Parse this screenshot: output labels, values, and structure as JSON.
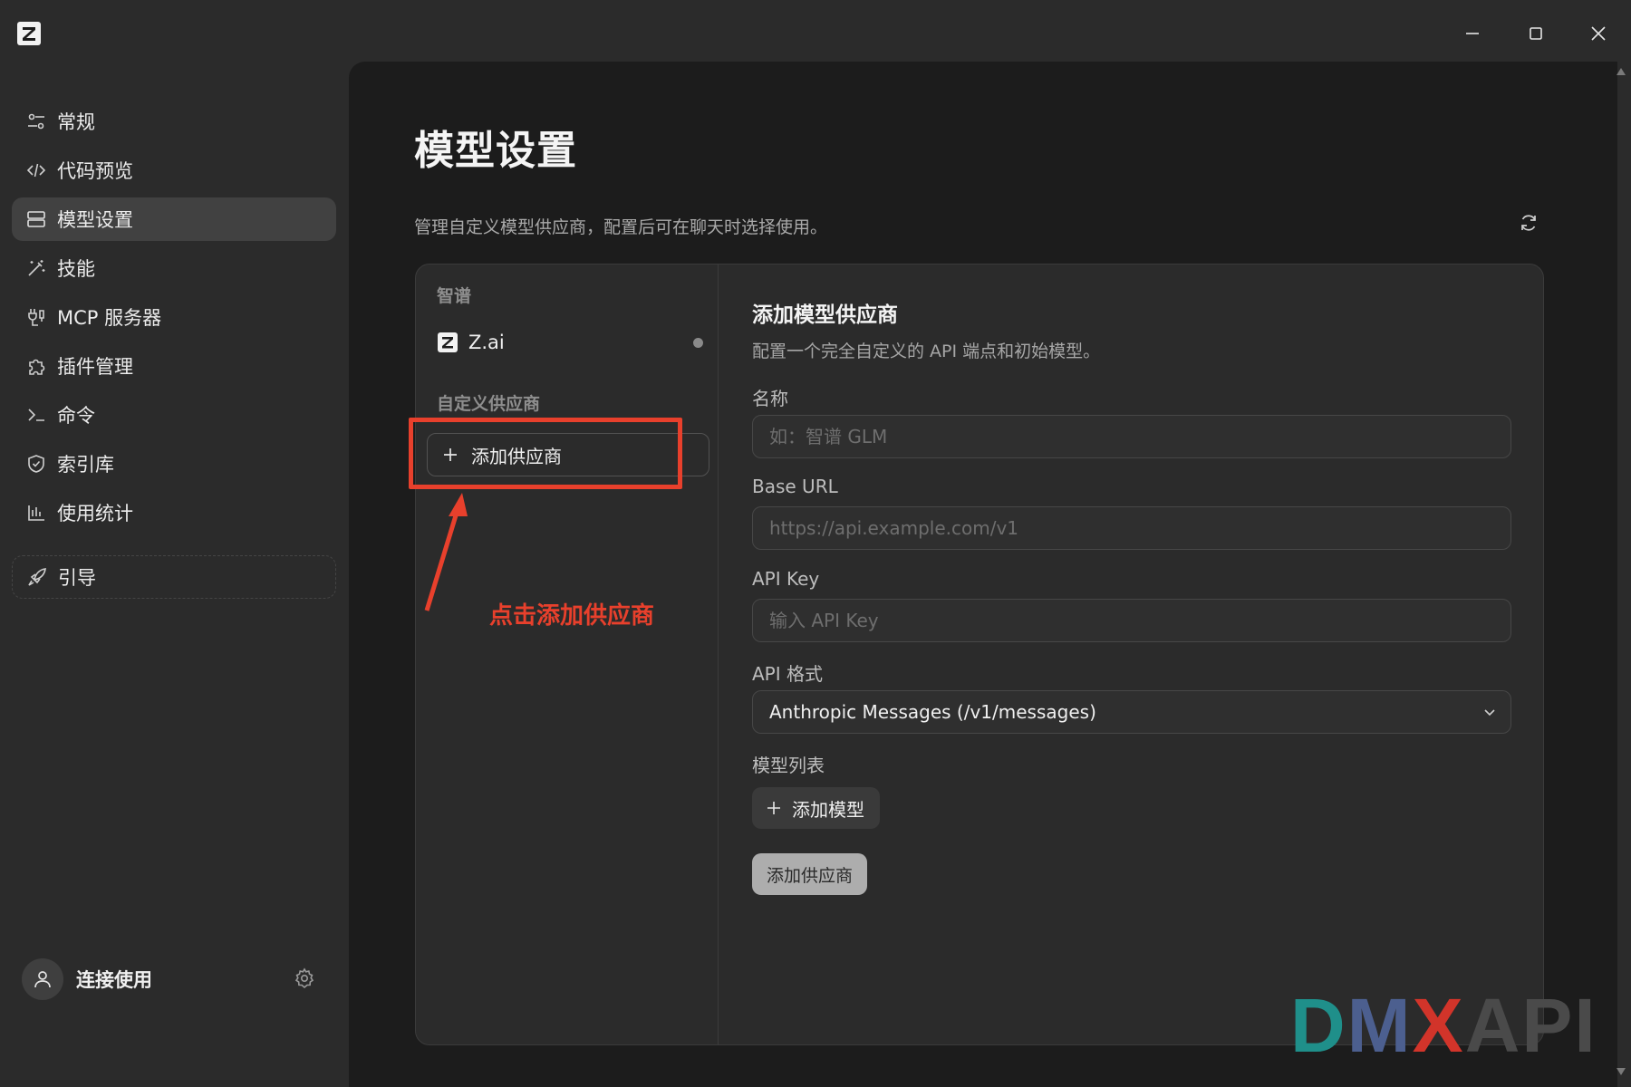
{
  "window": {
    "logo_icon": "z-logo-icon",
    "controls": [
      "minimize-icon",
      "maximize-icon",
      "close-icon"
    ]
  },
  "sidebar": {
    "items": [
      {
        "label": "常规",
        "icon": "sliders-icon"
      },
      {
        "label": "代码预览",
        "icon": "code-icon"
      },
      {
        "label": "模型设置",
        "icon": "server-icon",
        "active": true
      },
      {
        "label": "技能",
        "icon": "magic-wand-icon"
      },
      {
        "label": "MCP 服务器",
        "icon": "plug-icon"
      },
      {
        "label": "插件管理",
        "icon": "puzzle-icon"
      },
      {
        "label": "命令",
        "icon": "terminal-icon"
      },
      {
        "label": "索引库",
        "icon": "shield-icon"
      },
      {
        "label": "使用统计",
        "icon": "bar-chart-icon"
      }
    ],
    "guide": {
      "label": "引导",
      "icon": "rocket-icon"
    },
    "user": {
      "label": "连接使用",
      "icon": "user-icon",
      "settings_icon": "gear-icon"
    }
  },
  "main": {
    "title": "模型设置",
    "description": "管理自定义模型供应商，配置后可在聊天时选择使用。",
    "refresh_icon": "refresh-icon",
    "providers": {
      "group_builtin": "智谱",
      "builtin": [
        {
          "label": "Z.ai",
          "icon": "z-logo-icon"
        }
      ],
      "group_custom": "自定义供应商",
      "add_provider_label": "添加供应商"
    },
    "form": {
      "title": "添加模型供应商",
      "description": "配置一个完全自定义的 API 端点和初始模型。",
      "name_label": "名称",
      "name_placeholder": "如：智谱 GLM",
      "name_value": "",
      "base_url_label": "Base URL",
      "base_url_placeholder": "https://api.example.com/v1",
      "base_url_value": "",
      "api_key_label": "API Key",
      "api_key_placeholder": "输入 API Key",
      "api_key_value": "",
      "format_label": "API 格式",
      "format_value": "Anthropic Messages (/v1/messages)",
      "models_label": "模型列表",
      "add_model_label": "添加模型",
      "submit_label": "添加供应商"
    }
  },
  "annotation": {
    "text": "点击添加供应商",
    "color": "#e8402c"
  },
  "watermark": {
    "d": "D",
    "m": "M",
    "x": "X",
    "api": "API"
  }
}
